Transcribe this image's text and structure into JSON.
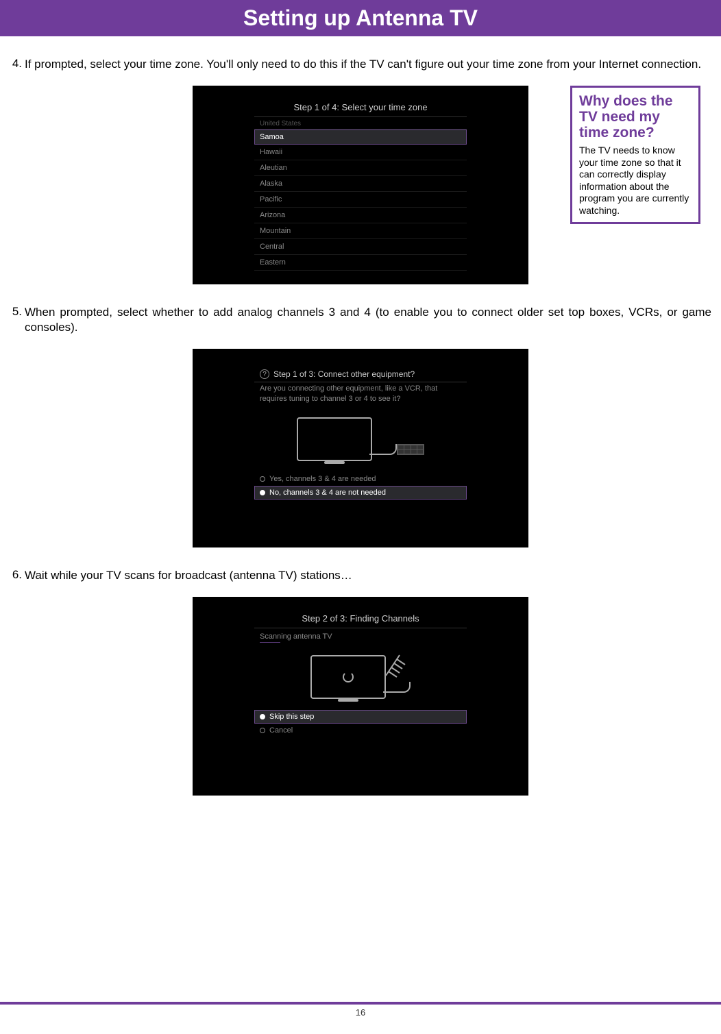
{
  "header": {
    "title": "Setting up Antenna TV"
  },
  "steps": {
    "s4": {
      "num": "4.",
      "text": "If prompted, select your time zone. You'll only need to do this if the TV can't figure out your time zone from your Internet connection."
    },
    "s5": {
      "num": "5.",
      "text": "When prompted, select whether to add analog channels 3 and 4 (to enable you to connect older set top boxes, VCRs, or game consoles)."
    },
    "s6": {
      "num": "6.",
      "text": "Wait while your TV scans for broadcast (antenna TV) stations…"
    }
  },
  "screenshot1": {
    "title": "Step 1 of 4: Select your time zone",
    "group": "United States",
    "items": [
      "Samoa",
      "Hawaii",
      "Aleutian",
      "Alaska",
      "Pacific",
      "Arizona",
      "Mountain",
      "Central",
      "Eastern"
    ],
    "selected": "Samoa"
  },
  "callout": {
    "title": "Why does the TV need my time zone?",
    "body": "The TV needs to know your time zone so that it can correctly display information about the program you are currently watching."
  },
  "screenshot2": {
    "title": "Step 1 of 3: Connect other equipment?",
    "question_icon": "?",
    "subtext": "Are you connecting other equipment, like a VCR, that requires tuning to channel 3 or 4 to see it?",
    "option_yes": "Yes, channels 3 & 4 are needed",
    "option_no": "No, channels 3 & 4 are not needed",
    "selected": "no"
  },
  "screenshot3": {
    "title": "Step 2 of 3: Finding Channels",
    "subtext": "Scanning antenna TV",
    "option_skip": "Skip this step",
    "option_cancel": "Cancel",
    "selected": "skip"
  },
  "footer": {
    "page_number": "16"
  }
}
